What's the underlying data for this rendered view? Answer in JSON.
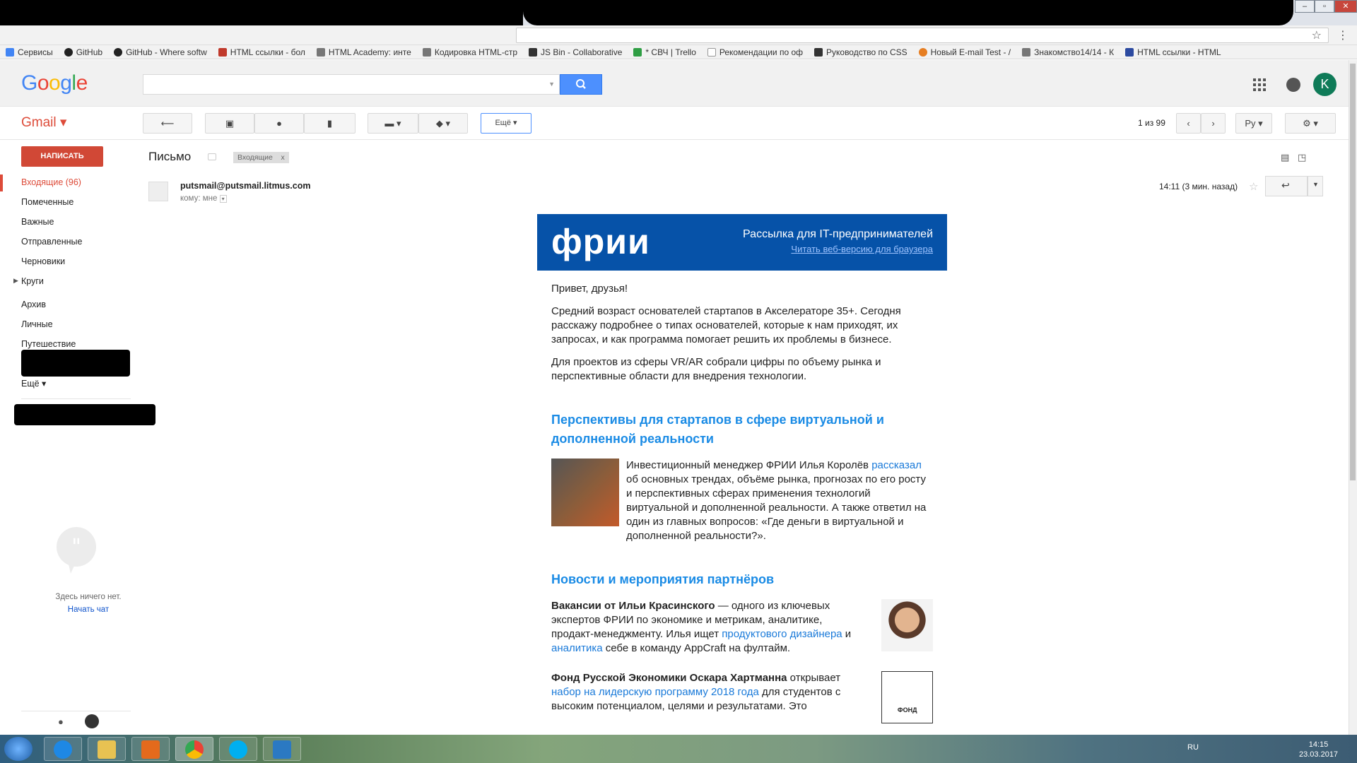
{
  "browser": {
    "bookmarks": [
      {
        "label": "Сервисы",
        "color": "#4285f4"
      },
      {
        "label": "GitHub",
        "color": "#222"
      },
      {
        "label": "GitHub - Where softw",
        "color": "#222"
      },
      {
        "label": "HTML ссылки - бол",
        "color": "#c0392b"
      },
      {
        "label": "HTML Academy: инте",
        "color": "#777"
      },
      {
        "label": "Кодировка HTML-стр",
        "color": "#777"
      },
      {
        "label": "JS Bin - Collaborative",
        "color": "#333"
      },
      {
        "label": "* СВЧ | Trello",
        "color": "#2f9e44"
      },
      {
        "label": "Рекомендации по оф",
        "color": "#999"
      },
      {
        "label": "Руководство по CSS",
        "color": "#333"
      },
      {
        "label": "Новый E-mail Test - /",
        "color": "#e67e22"
      },
      {
        "label": "Знакомство14/14 - К",
        "color": "#777"
      },
      {
        "label": "HTML ссылки - HTML",
        "color": "#2c4aa0"
      }
    ]
  },
  "gmail": {
    "app_label": "Gmail ▾",
    "compose": "НАПИСАТЬ",
    "nav": [
      {
        "label": "Входящие (96)",
        "active": true
      },
      {
        "label": "Помеченные"
      },
      {
        "label": "Важные"
      },
      {
        "label": "Отправленные"
      },
      {
        "label": "Черновики"
      },
      {
        "label": "Круги"
      },
      {
        "label": "Архив"
      },
      {
        "label": "Личные"
      },
      {
        "label": "Путешествие"
      },
      {
        "label": "Ещё ▾"
      }
    ],
    "chat_empty": "Здесь ничего нет.",
    "chat_start": "Начать чат",
    "avatar_letter": "K",
    "toolbar": {
      "more": "Ещё ▾",
      "pager": "1 из 99",
      "lang": "Ру"
    }
  },
  "message": {
    "subject": "Письмо",
    "label": "Входящие",
    "sender": "putsmail@putsmail.litmus.com",
    "to": "кому: мне",
    "time": "14:11 (3 мин. назад)"
  },
  "email": {
    "banner_logo": "фрии",
    "banner_title": "Рассылка для IT-предпринимателей",
    "banner_link": "Читать веб-версию для браузера",
    "greeting": "Привет, друзья!",
    "p1": "Средний возраст основателей стартапов в Акселераторе 35+. Сегодня расскажу подробнее о типах основателей, которые к нам приходят, их запросах, и как программа помогает решить их проблемы в бизнесе.",
    "p2": "Для проектов из сферы VR/AR собрали цифры по объему рынка и перспективные области для внедрения технологии.",
    "section1_title": "Перспективы для стартапов в сфере виртуальной и дополненной реальности",
    "article_pre": "Инвестиционный менеджер ФРИИ Илья Королёв ",
    "article_link": "рассказал",
    "article_post": " об основных трендах, объёме рынка, прогнозах по его росту и перспективных сферах применения технологий виртуальной и дополненной реальности. А также ответил на один из главных вопросов: «Где деньги в виртуальной и дополненной реальности?».",
    "section2_title": "Новости и мероприятия партнёров",
    "news1_bold": "Вакансии от Ильи Красинского",
    "news1_a": " — одного из ключевых экспертов ФРИИ по экономике и метрикам, аналитике, продакт-менеджменту. Илья ищет ",
    "news1_link1": "продуктового дизайнера",
    "news1_b": " и ",
    "news1_link2": "аналитика",
    "news1_c": " себе в команду AppCraft на фултайм.",
    "news2_bold": "Фонд Русской Экономики Оскара Хартманна",
    "news2_a": " открывает ",
    "news2_link": "набор на лидерскую программу 2018 года",
    "news2_b": " для студентов с высоким потенциалом, целями и результатами. Это",
    "news2_logo": "ФОНД"
  },
  "taskbar": {
    "lang": "RU",
    "time": "14:15",
    "date": "23.03.2017"
  }
}
